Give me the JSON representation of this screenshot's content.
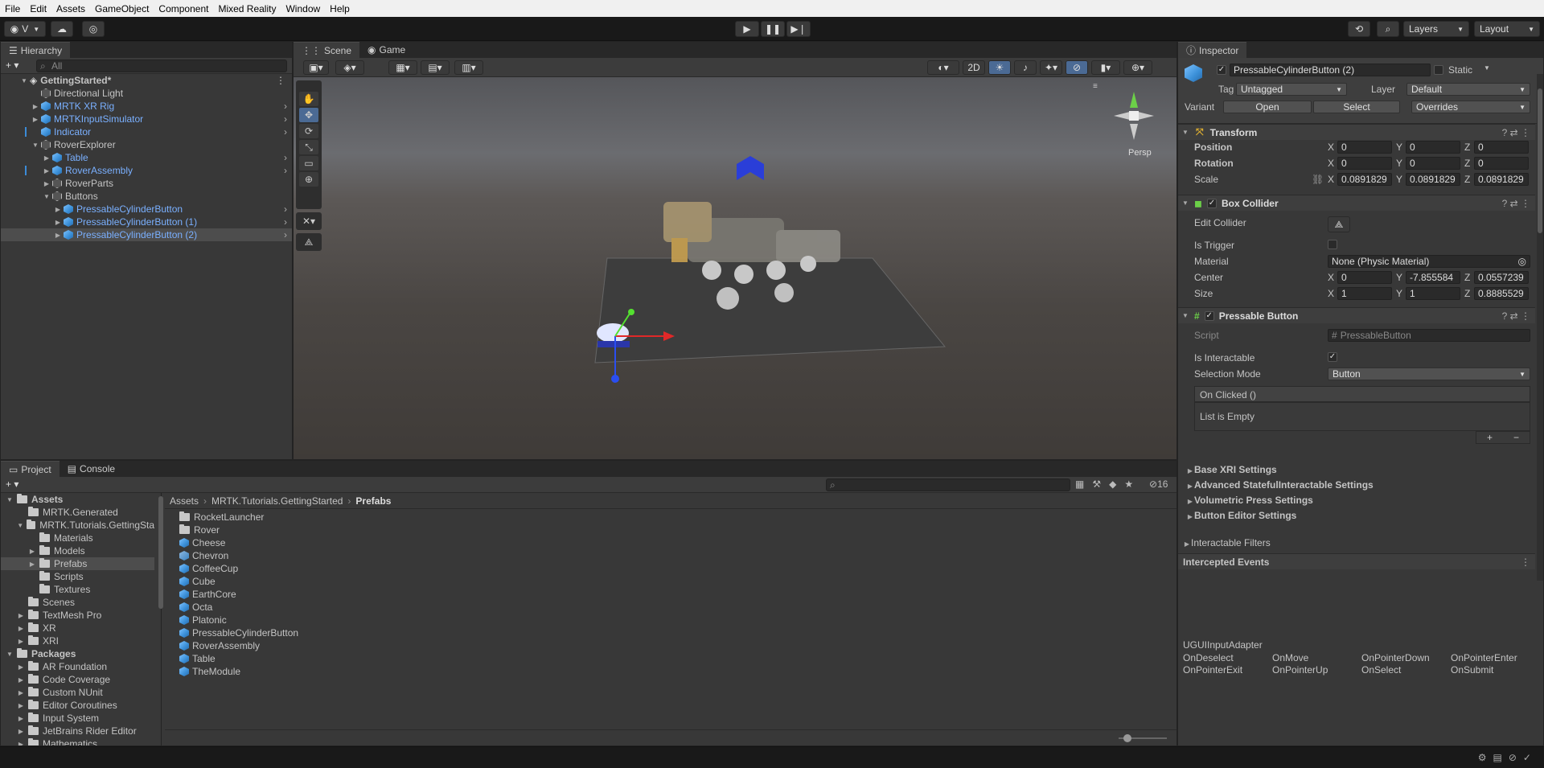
{
  "menu": [
    "File",
    "Edit",
    "Assets",
    "GameObject",
    "Component",
    "Mixed Reality",
    "Window",
    "Help"
  ],
  "toolbar": {
    "account": "V",
    "layers": "Layers",
    "layout": "Layout"
  },
  "hierarchy": {
    "tab": "Hierarchy",
    "search_placeholder": "All",
    "items": [
      {
        "label": "GettingStarted*",
        "indent": 0,
        "kind": "scene",
        "bold": true
      },
      {
        "label": "Directional Light",
        "indent": 1,
        "kind": "go"
      },
      {
        "label": "MRTK XR Rig",
        "indent": 1,
        "kind": "prefab"
      },
      {
        "label": "MRTKInputSimulator",
        "indent": 1,
        "kind": "prefab"
      },
      {
        "label": "Indicator",
        "indent": 1,
        "kind": "prefab"
      },
      {
        "label": "RoverExplorer",
        "indent": 1,
        "kind": "go"
      },
      {
        "label": "Table",
        "indent": 2,
        "kind": "prefab"
      },
      {
        "label": "RoverAssembly",
        "indent": 2,
        "kind": "prefab"
      },
      {
        "label": "RoverParts",
        "indent": 2,
        "kind": "go"
      },
      {
        "label": "Buttons",
        "indent": 2,
        "kind": "go"
      },
      {
        "label": "PressableCylinderButton",
        "indent": 3,
        "kind": "prefab"
      },
      {
        "label": "PressableCylinderButton (1)",
        "indent": 3,
        "kind": "prefab"
      },
      {
        "label": "PressableCylinderButton (2)",
        "indent": 3,
        "kind": "prefab",
        "selected": true
      }
    ]
  },
  "scene": {
    "tab_scene": "Scene",
    "tab_game": "Game",
    "mode_2d": "2D",
    "persp": "Persp"
  },
  "inspector": {
    "tab": "Inspector",
    "object_name": "PressableCylinderButton (2)",
    "static_label": "Static",
    "tag_label": "Tag",
    "tag_value": "Untagged",
    "layer_label": "Layer",
    "layer_value": "Default",
    "variant_label": "Variant",
    "open": "Open",
    "select": "Select",
    "overrides": "Overrides",
    "transform": {
      "title": "Transform",
      "position": "Position",
      "rotation": "Rotation",
      "scale": "Scale",
      "pos": [
        "0",
        "0",
        "0"
      ],
      "rot": [
        "0",
        "0",
        "0"
      ],
      "scl": [
        "0.0891829",
        "0.0891829",
        "0.0891829"
      ]
    },
    "box_collider": {
      "title": "Box Collider",
      "edit": "Edit Collider",
      "trigger": "Is Trigger",
      "material": "Material",
      "material_value": "None (Physic Material)",
      "center": "Center",
      "size": "Size",
      "center_v": [
        "0",
        "-7.855584",
        "0.0557239"
      ],
      "size_v": [
        "1",
        "1",
        "0.8885529"
      ]
    },
    "pressable": {
      "title": "Pressable Button",
      "script": "Script",
      "script_value": "PressableButton",
      "interactable": "Is Interactable",
      "selection": "Selection Mode",
      "selection_value": "Button",
      "on_clicked": "On Clicked ()",
      "empty": "List is Empty"
    },
    "sections": [
      "Base XRI Settings",
      "Advanced StatefulInteractable Settings",
      "Volumetric Press Settings",
      "Button Editor Settings"
    ],
    "filters": "Interactable Filters",
    "intercepted": "Intercepted Events",
    "adapter": "UGUIInputAdapter",
    "events": [
      "OnDeselect",
      "OnMove",
      "OnPointerDown",
      "OnPointerEnter",
      "OnPointerExit",
      "OnPointerUp",
      "OnSelect",
      "OnSubmit"
    ]
  },
  "project": {
    "tab_project": "Project",
    "tab_console": "Console",
    "hidden_count": "16",
    "breadcrumb": [
      "Assets",
      "MRTK.Tutorials.GettingStarted",
      "Prefabs"
    ],
    "tree": [
      {
        "label": "Assets",
        "indent": 0,
        "bold": true,
        "open": true
      },
      {
        "label": "MRTK.Generated",
        "indent": 1
      },
      {
        "label": "MRTK.Tutorials.GettingSta",
        "indent": 1,
        "open": true
      },
      {
        "label": "Materials",
        "indent": 2
      },
      {
        "label": "Models",
        "indent": 2,
        "arrow": true
      },
      {
        "label": "Prefabs",
        "indent": 2,
        "arrow": true,
        "selected": true
      },
      {
        "label": "Scripts",
        "indent": 2
      },
      {
        "label": "Textures",
        "indent": 2
      },
      {
        "label": "Scenes",
        "indent": 1
      },
      {
        "label": "TextMesh Pro",
        "indent": 1,
        "arrow": true
      },
      {
        "label": "XR",
        "indent": 1,
        "arrow": true
      },
      {
        "label": "XRI",
        "indent": 1,
        "arrow": true
      },
      {
        "label": "Packages",
        "indent": 0,
        "bold": true,
        "open": true
      },
      {
        "label": "AR Foundation",
        "indent": 1,
        "arrow": true
      },
      {
        "label": "Code Coverage",
        "indent": 1,
        "arrow": true
      },
      {
        "label": "Custom NUnit",
        "indent": 1,
        "arrow": true
      },
      {
        "label": "Editor Coroutines",
        "indent": 1,
        "arrow": true
      },
      {
        "label": "Input System",
        "indent": 1,
        "arrow": true
      },
      {
        "label": "JetBrains Rider Editor",
        "indent": 1,
        "arrow": true
      },
      {
        "label": "Mathematics",
        "indent": 1,
        "arrow": true
      }
    ],
    "files": [
      {
        "label": "RocketLauncher",
        "kind": "folder"
      },
      {
        "label": "Rover",
        "kind": "folder"
      },
      {
        "label": "Cheese",
        "kind": "prefab"
      },
      {
        "label": "Chevron",
        "kind": "prefabvar"
      },
      {
        "label": "CoffeeCup",
        "kind": "prefab"
      },
      {
        "label": "Cube",
        "kind": "prefab"
      },
      {
        "label": "EarthCore",
        "kind": "prefab"
      },
      {
        "label": "Octa",
        "kind": "prefab"
      },
      {
        "label": "Platonic",
        "kind": "prefab"
      },
      {
        "label": "PressableCylinderButton",
        "kind": "prefab"
      },
      {
        "label": "RoverAssembly",
        "kind": "prefab"
      },
      {
        "label": "Table",
        "kind": "prefab"
      },
      {
        "label": "TheModule",
        "kind": "prefab"
      }
    ]
  }
}
